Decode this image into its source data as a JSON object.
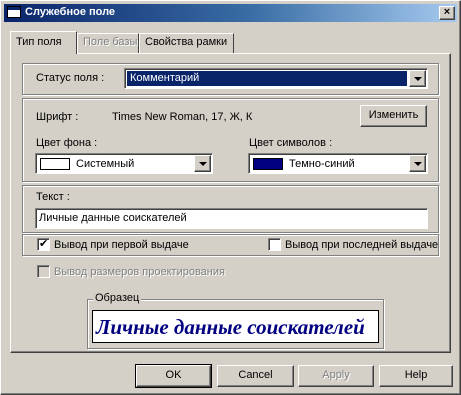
{
  "window": {
    "title": "Служебное поле",
    "close_glyph": "×"
  },
  "tabs": [
    {
      "label": "Тип поля",
      "state": "active"
    },
    {
      "label": "Поле базы",
      "state": "disabled"
    },
    {
      "label": "Свойства рамки",
      "state": "normal"
    }
  ],
  "status": {
    "label": "Статус поля :",
    "value": "Комментарий"
  },
  "font": {
    "label": "Шрифт :",
    "value": "Times New Roman, 17, Ж, К",
    "change_button": "Изменить"
  },
  "background_color": {
    "label": "Цвет фона :",
    "value": "Системный",
    "swatch": "#ffffff"
  },
  "text_color": {
    "label": "Цвет символов :",
    "value": "Темно-синий",
    "swatch": "#000080"
  },
  "text": {
    "label": "Текст :",
    "value": "Личные данные соискателей"
  },
  "checkboxes": {
    "first_issue": {
      "label": "Вывод при первой выдаче",
      "checked": true
    },
    "last_issue": {
      "label": "Вывод при последней выдаче",
      "checked": false
    },
    "design_sizes": {
      "label": "Вывод размеров проектирования",
      "checked": false,
      "disabled": true
    }
  },
  "check_glyph": "✔",
  "sample": {
    "caption": "Образец",
    "text": "Личные данные соискателей",
    "color": "#000080"
  },
  "buttons": {
    "ok": "OK",
    "cancel": "Cancel",
    "apply": "Apply",
    "help": "Help"
  }
}
